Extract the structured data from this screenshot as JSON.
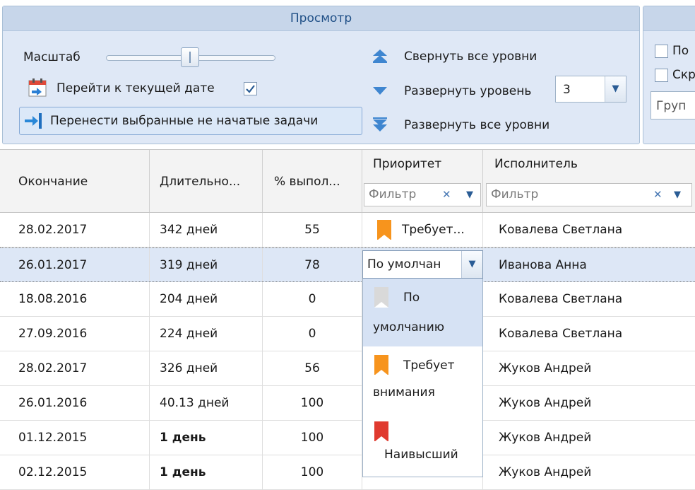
{
  "ribbon": {
    "view_group": {
      "title": "Просмотр",
      "scale_label": "Масштаб",
      "goto_today_label": "Перейти к текущей дате",
      "goto_today_checked": true,
      "move_tasks_label": "Перенести выбранные не начатые задачи",
      "collapse_all_label": "Свернуть все уровни",
      "expand_level_label": "Развернуть уровень",
      "expand_level_value": "3",
      "expand_all_label": "Развернуть все уровни"
    },
    "right_group": {
      "option1_label": "По",
      "option2_label": "Скр",
      "group_combo_value": "Груп"
    }
  },
  "grid": {
    "columns": {
      "end": "Окончание",
      "duration": "Длительно...",
      "percent": "% выпол...",
      "priority": "Приоритет",
      "assignee": "Исполнитель"
    },
    "filter_placeholder": "Фильтр",
    "rows": [
      {
        "end": "28.02.2017",
        "duration": "342 дней",
        "percent": "55",
        "priority": "Требует...",
        "assignee": "Ковалева Светлана"
      },
      {
        "end": "26.01.2017",
        "duration": "319 дней",
        "percent": "78",
        "priority": "По умолчан",
        "assignee": "Иванова Анна"
      },
      {
        "end": "18.08.2016",
        "duration": "204 дней",
        "percent": "0",
        "priority": "",
        "assignee": "Ковалева Светлана"
      },
      {
        "end": "27.09.2016",
        "duration": "224 дней",
        "percent": "0",
        "priority": "",
        "assignee": "Ковалева Светлана"
      },
      {
        "end": "28.02.2017",
        "duration": "326 дней",
        "percent": "56",
        "priority": "",
        "assignee": "Жуков Андрей"
      },
      {
        "end": "26.01.2016",
        "duration": "40.13 дней",
        "percent": "100",
        "priority": "",
        "assignee": "Жуков Андрей"
      },
      {
        "end": "01.12.2015",
        "duration": "1 день",
        "percent": "100",
        "priority": "",
        "assignee": "Жуков Андрей"
      },
      {
        "end": "02.12.2015",
        "duration": "1 день",
        "percent": "100",
        "priority": "",
        "assignee": "Жуков Андрей"
      }
    ],
    "priority_editor": {
      "value": "По умолчан",
      "options": [
        {
          "line1": "По",
          "line2": "умолчанию",
          "flag_color": "#d9d9d9",
          "selected": true
        },
        {
          "line1": "Требует",
          "line2": "внимания",
          "flag_color": "#f7941d",
          "selected": false
        },
        {
          "line1": "",
          "line2": "Наивысший",
          "flag_color": "#e03a2f",
          "selected": false
        }
      ]
    }
  },
  "colors": {
    "flag_attention": "#f7941d",
    "flag_default": "#d9d9d9",
    "flag_highest": "#e03a2f",
    "selection": "#dde7f6",
    "ribbon_bg": "#dfe8f6",
    "accent": "#2a6ebb"
  }
}
